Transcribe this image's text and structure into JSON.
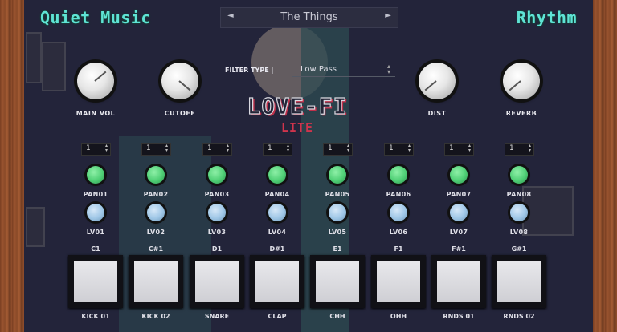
{
  "header": {
    "title_left": "Quiet Music",
    "title_right": "Rhythm",
    "preset": {
      "prev": "◄",
      "next": "►",
      "name": "The Things"
    }
  },
  "knobs": [
    {
      "label": "MAIN VOL"
    },
    {
      "label": "CUTOFF"
    },
    {
      "label": "DIST"
    },
    {
      "label": "REVERB"
    }
  ],
  "filter": {
    "label": "FILTER TYPE |",
    "value": "Low Pass"
  },
  "logo": {
    "main": "LOVE-FI",
    "sub": "LITE"
  },
  "channels": [
    {
      "spin": "1",
      "pan": "PAN01",
      "lvl": "LV01",
      "note": "C1",
      "pad": "KICK 01"
    },
    {
      "spin": "1",
      "pan": "PAN02",
      "lvl": "LV02",
      "note": "C#1",
      "pad": "KICK 02"
    },
    {
      "spin": "1",
      "pan": "PAN03",
      "lvl": "LV03",
      "note": "D1",
      "pad": "SNARE"
    },
    {
      "spin": "1",
      "pan": "PAN04",
      "lvl": "LV04",
      "note": "D#1",
      "pad": "CLAP"
    },
    {
      "spin": "1",
      "pan": "PAN05",
      "lvl": "LV05",
      "note": "E1",
      "pad": "CHH"
    },
    {
      "spin": "1",
      "pan": "PAN06",
      "lvl": "LV06",
      "note": "F1",
      "pad": "OHH"
    },
    {
      "spin": "1",
      "pan": "PAN07",
      "lvl": "LV07",
      "note": "F#1",
      "pad": "RNDS 01"
    },
    {
      "spin": "1",
      "pan": "PAN08",
      "lvl": "LV08",
      "note": "G#1",
      "pad": "RNDS 02"
    }
  ],
  "colors": {
    "title": "#5fe3d5",
    "logo_accent": "#d0344c",
    "pan_knob": "#4fcf75",
    "level_knob": "#9ec6e6"
  }
}
